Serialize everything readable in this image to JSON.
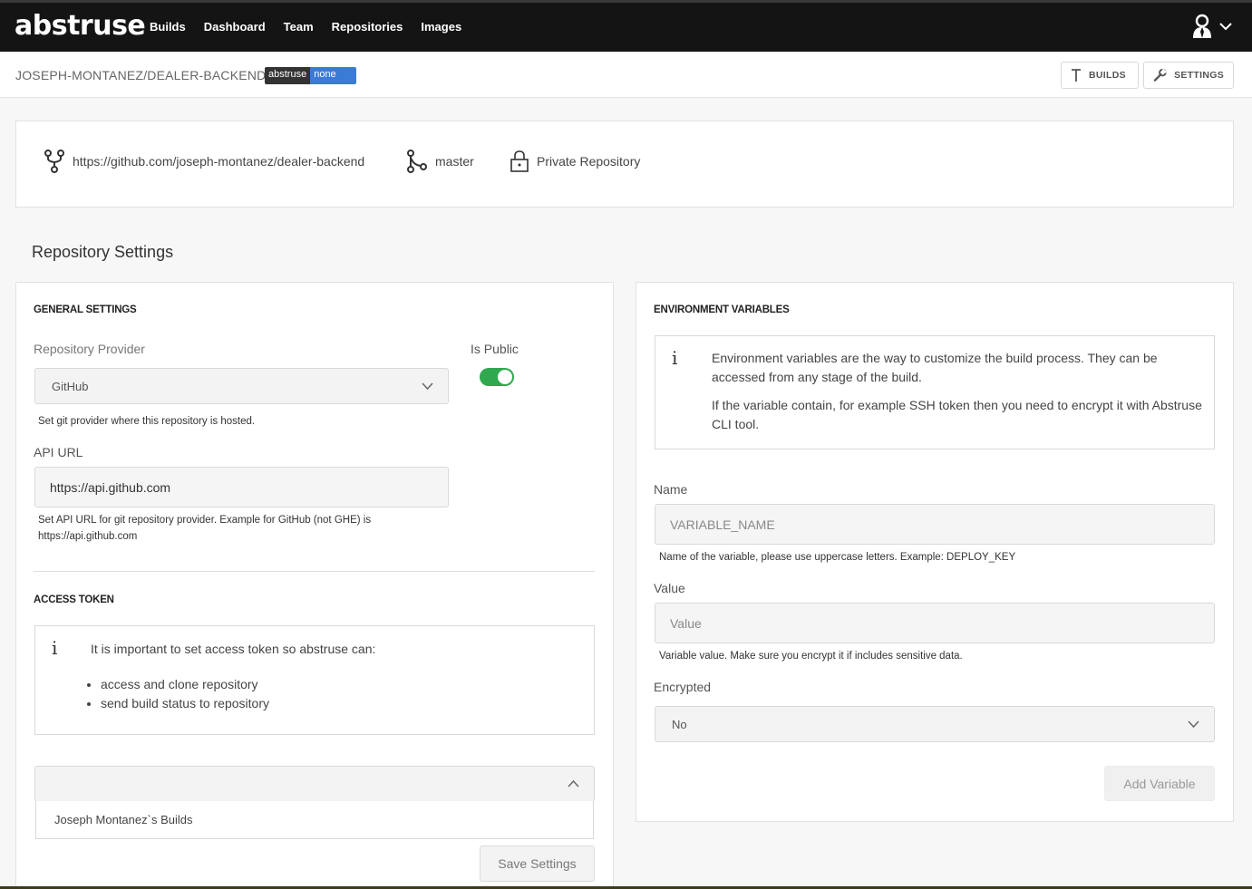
{
  "app": {
    "logo": "abstruse"
  },
  "nav": {
    "items": [
      "Builds",
      "Dashboard",
      "Team",
      "Repositories",
      "Images"
    ]
  },
  "header": {
    "repo_name": "JOSEPH-MONTANEZ/DEALER-BACKEND",
    "badge_left": "abstruse",
    "badge_right": "none",
    "builds_label": "BUILDS",
    "settings_label": "SETTINGS"
  },
  "repo_info": {
    "url": "https://github.com/joseph-montanez/dealer-backend",
    "branch": "master",
    "visibility": "Private Repository"
  },
  "page_title": "Repository Settings",
  "general": {
    "title": "GENERAL SETTINGS",
    "provider_label": "Repository Provider",
    "provider_value": "GitHub",
    "provider_help": "Set git provider where this repository is hosted.",
    "is_public_label": "Is Public",
    "is_public": true,
    "api_url_label": "API URL",
    "api_url_value": "https://api.github.com",
    "api_url_help_1": "Set API URL for git repository provider. Example for GitHub (not GHE) is",
    "api_url_help_2": "https://api.github.com"
  },
  "access_token": {
    "title": "ACCESS TOKEN",
    "info_text": "It is important to set access token so abstruse can:",
    "bullets": [
      "access and clone repository",
      "send build status to repository"
    ],
    "dropdown_option": "Joseph Montanez`s Builds",
    "save_label": "Save Settings"
  },
  "env": {
    "title": "ENVIRONMENT VARIABLES",
    "info_p1": "Environment variables are the way to customize the build process. They can be accessed from any stage of the build.",
    "info_p2": "If the variable contain, for example SSH token then you need to encrypt it with Abstruse CLI tool.",
    "name_label": "Name",
    "name_placeholder": "VARIABLE_NAME",
    "name_help": "Name of the variable, please use uppercase letters. Example: DEPLOY_KEY",
    "value_label": "Value",
    "value_placeholder": "Value",
    "value_help": "Variable value. Make sure you encrypt it if includes sensitive data.",
    "encrypted_label": "Encrypted",
    "encrypted_value": "No",
    "add_label": "Add Variable"
  },
  "icons": {
    "user": "user-icon",
    "caret": "chevron-down-icon",
    "fork": "fork-icon",
    "branch": "branch-icon",
    "lock": "lock-icon",
    "info": "info-icon"
  },
  "colors": {
    "topbar": "#141414",
    "toggle_on": "#2fa84f",
    "badge_blue": "#3a7bd5"
  }
}
